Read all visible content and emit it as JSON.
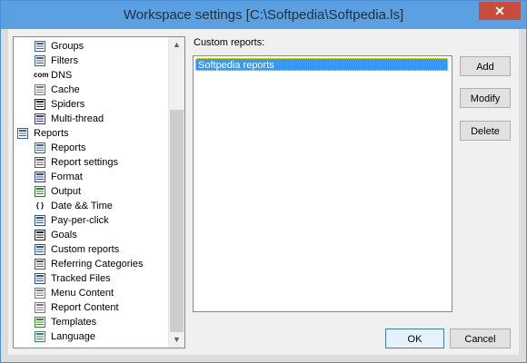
{
  "window": {
    "title": "Workspace settings [C:\\Softpedia\\Softpedia.ls]",
    "close_glyph": "✕"
  },
  "tree": {
    "items": [
      {
        "label": "Groups",
        "icon": "groups-icon",
        "indent": 1,
        "color": "#3a5fa0"
      },
      {
        "label": "Filters",
        "icon": "filters-icon",
        "indent": 1,
        "color": "#3a5fa0"
      },
      {
        "label": "DNS",
        "icon": "dns-icon",
        "indent": 1,
        "color": "#000000",
        "text_icon": "com"
      },
      {
        "label": "Cache",
        "icon": "cache-icon",
        "indent": 1,
        "color": "#777777"
      },
      {
        "label": "Spiders",
        "icon": "spider-icon",
        "indent": 1,
        "color": "#222222"
      },
      {
        "label": "Multi-thread",
        "icon": "multithread-icon",
        "indent": 1,
        "color": "#333399"
      },
      {
        "label": "Reports",
        "icon": "reports-folder-icon",
        "indent": 0,
        "color": "#3a5fa0"
      },
      {
        "label": "Reports",
        "icon": "reports-icon",
        "indent": 1,
        "color": "#3a5fa0"
      },
      {
        "label": "Report settings",
        "icon": "report-settings-icon",
        "indent": 1,
        "color": "#555555"
      },
      {
        "label": "Format",
        "icon": "format-icon",
        "indent": 1,
        "color": "#2040c0"
      },
      {
        "label": "Output",
        "icon": "output-icon",
        "indent": 1,
        "color": "#2a8a2a"
      },
      {
        "label": "Date && Time",
        "icon": "braces-icon",
        "indent": 1,
        "color": "#000000",
        "text_icon": "{ }"
      },
      {
        "label": "Pay-per-click",
        "icon": "pay-per-click-icon",
        "indent": 1,
        "color": "#2050b0"
      },
      {
        "label": "Goals",
        "icon": "goals-icon",
        "indent": 1,
        "color": "#222222"
      },
      {
        "label": "Custom reports",
        "icon": "custom-reports-icon",
        "indent": 1,
        "color": "#2050b0"
      },
      {
        "label": "Referring Categories",
        "icon": "referring-categories-icon",
        "indent": 1,
        "color": "#555555"
      },
      {
        "label": "Tracked Files",
        "icon": "tracked-files-icon",
        "indent": 1,
        "color": "#2050b0"
      },
      {
        "label": "Menu Content",
        "icon": "menu-content-icon",
        "indent": 1,
        "color": "#777777"
      },
      {
        "label": "Report Content",
        "icon": "report-content-icon",
        "indent": 1,
        "color": "#777777"
      },
      {
        "label": "Templates",
        "icon": "templates-icon",
        "indent": 1,
        "color": "#2a8a2a"
      },
      {
        "label": "Language",
        "icon": "globe-icon",
        "indent": 1,
        "color": "#2a8a6a"
      }
    ]
  },
  "custom_reports": {
    "label": "Custom reports:",
    "items": [
      {
        "label": "Softpedia reports",
        "selected": true
      }
    ]
  },
  "buttons": {
    "add": "Add",
    "modify": "Modify",
    "delete": "Delete",
    "ok": "OK",
    "cancel": "Cancel"
  },
  "scroll_glyphs": {
    "up": "▲",
    "down": "▼"
  }
}
